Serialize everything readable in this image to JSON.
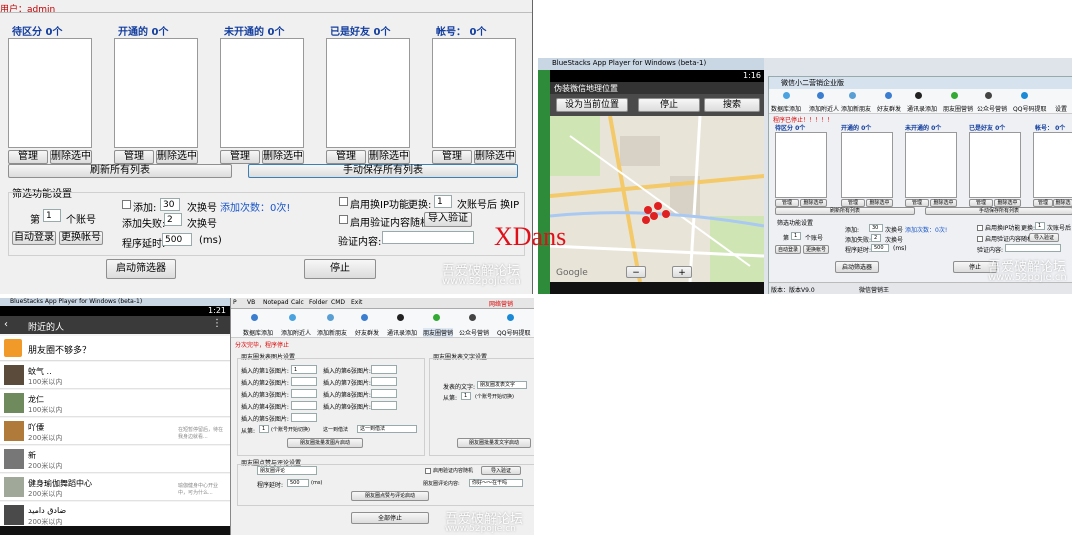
{
  "q1": {
    "user_label": "用户：admin",
    "columns": [
      {
        "header": "待区分 0个",
        "manage": "管理",
        "delete": "删除选中"
      },
      {
        "header": "开通的 0个",
        "manage": "管理",
        "delete": "删除选中"
      },
      {
        "header": "未开通的 0个",
        "manage": "管理",
        "delete": "删除选中"
      },
      {
        "header": "已是好友 0个",
        "manage": "管理",
        "delete": "删除选中"
      },
      {
        "header": "帐号： 0个",
        "manage": "管理",
        "delete": "删除选中"
      }
    ],
    "refresh_all": "刷新所有列表",
    "manual_save": "手动保存所有列表",
    "filter_title": "筛选功能设置",
    "nth_label": "第",
    "nth_value": "1",
    "account_unit": "个账号",
    "auto_login": "自动登录",
    "switch_account": "更换帐号",
    "add_label": "添加:",
    "add_value": "30",
    "times_switch": "次换号",
    "add_count": "添加次数：0次!",
    "fail_label": "添加失败:",
    "fail_value": "2",
    "times_switch2": "次换号",
    "delay_label": "程序延时:",
    "delay_value": "500",
    "delay_unit": "(ms)",
    "ip_label": "启用换IP功能",
    "swap_label": "更换:",
    "swap_value": "1",
    "swap_suffix": "次账号后 换IP",
    "verify_label": "启用验证内容随机",
    "import_verify": "导入验证",
    "verify_content": "验证内容:",
    "start_filter": "启动筛选器",
    "stop": "停止",
    "wm1": "吾爱破解论坛",
    "wm2": "www.52pojie.cn"
  },
  "overlay_text": "XDans",
  "q2": {
    "bs_title": "BlueStacks App Player for Windows (beta-1)",
    "time": "1:16",
    "map_title": "伪装微信地理位置",
    "set_current": "设为当前位置",
    "stop": "停止",
    "search": "搜索",
    "google": "Google",
    "app_title": "微信小二营销企业版",
    "tabs": [
      "数据库添加",
      "添加附近人",
      "添加新朋友",
      "好友群发",
      "通讯录添加",
      "朋友圈营销",
      "公众号营销",
      "QQ号码提取",
      "设置"
    ],
    "notice": "程序已停止！！！！！",
    "headers": [
      "待区分 0个",
      "开通的 0个",
      "未开通的 0个",
      "已是好友 0个",
      "帐号： 0个"
    ],
    "manage": "管理",
    "delete": "删除选中",
    "refresh_all": "刷新所有列表",
    "manual_save": "手动保存所有列表",
    "filter_title": "筛选功能设置",
    "nth": "第",
    "nth_value": "1",
    "nth_unit": "个账号",
    "add_label": "添加:",
    "add_value": "30",
    "add_unit": "次换号",
    "add_count": "添加次数：0次!",
    "fail_label": "添加失败:",
    "fail_value": "2",
    "fail_unit": "次换号",
    "delay_label": "程序延时:",
    "delay_value": "500",
    "delay_unit": "(ms)",
    "ip_label": "启用换IP功能",
    "swap_label": "更换:",
    "swap_value": "1",
    "swap_suffix": "次账号后 换IP",
    "verify_label": "启用验证内容随机",
    "import_verify": "导入验证",
    "verify_content": "验证内容:",
    "auto_login": "自动登录",
    "switch_account": "更换帐号",
    "start_filter": "启动筛选器",
    "stop2": "停止",
    "status_left": "版本：版本V9.0",
    "status_mid": "微信营销王",
    "wm1": "吾爱破解论坛",
    "wm2": "www.52pojie.cn"
  },
  "q3": {
    "bs_title": "BlueStacks App Player for Windows (beta-1)",
    "time": "1:21",
    "nav_title": "附近的人",
    "banner": "朋友圈不够多？",
    "people": [
      {
        "name": "蚊气 ..",
        "dist": "100米以内",
        "sig": ""
      },
      {
        "name": "龙仁",
        "dist": "100米以内",
        "sig": ""
      },
      {
        "name": "吖僳",
        "dist": "200米以内",
        "sig": "在短暂停留后，待在我身边就看..."
      },
      {
        "name": "新",
        "dist": "200米以内",
        "sig": ""
      },
      {
        "name": "健身瑜伽舞蹈中心",
        "dist": "200米以内",
        "sig": "瑜伽健身中心开业中，可为什么..."
      },
      {
        "name": "ضادق داميد",
        "dist": "200米以内",
        "sig": ""
      }
    ]
  },
  "q4": {
    "menu": [
      "P",
      "VB",
      "Notepad",
      "Calc",
      "Folder",
      "CMD",
      "Exit"
    ],
    "top_red": "网络营销",
    "tabs": [
      "数据库添加",
      "添加附近人",
      "添加新朋友",
      "好友群发",
      "通讯录添加",
      "朋友圈营销",
      "公众号营销",
      "QQ号码提取"
    ],
    "notice": "分次完毕，程序停止",
    "img_group": "朋友圈发表图片设置",
    "text_group": "朋友圈发表文字设置",
    "insert_labels": [
      "插入的第1张图片:",
      "插入的第2张图片:",
      "插入的第3张图片:",
      "插入的第4张图片:",
      "插入的第5张图片:"
    ],
    "insert_labels_r": [
      "插入的第6张图片:",
      "插入的第7张图片:",
      "插入的第8张图片:",
      "插入的第9张图片:"
    ],
    "first_value": "1",
    "from_label": "从第:",
    "from_value": "1",
    "from_suffix": "(个账号开始切换)",
    "to_label": "这一到借法",
    "to_value": "这一到借法",
    "batch_img": "朋友圈批量发图片启动",
    "text_label": "发表的文字:",
    "text_value": "朋友圈发表文字",
    "from2_label": "从第:",
    "from2_value": "1",
    "from2_suffix": "(个账号开始切换)",
    "batch_text": "朋友圈批量发文字启动",
    "like_group": "朋友圈点赞与评论设置",
    "comment_select": "朋友圈评论",
    "verify_label": "启用验证内容随机",
    "import_verify": "导入验证",
    "comment_label": "朋友圈评论内容:",
    "comment_value": "你好～～在干吗",
    "delay_label": "程序延时:",
    "delay_value": "500",
    "delay_unit": "(ms)",
    "like_start": "朋友圈点赞与评论启动",
    "stop_all": "全部停止",
    "wm1": "吾爱破解论坛",
    "wm2": "www.52pojie.cn"
  }
}
